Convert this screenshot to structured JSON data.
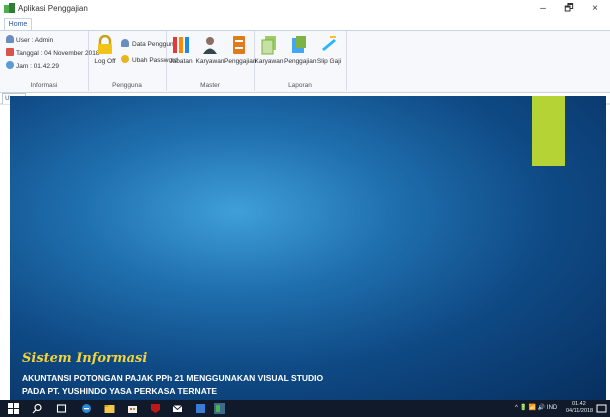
{
  "window": {
    "title": "Aplikasi Penggajian",
    "minimize": "–",
    "restore": "🗗",
    "close": "×"
  },
  "ribbon": {
    "tab_home": "Home",
    "informasi": {
      "user": "User : Admin",
      "tanggal": "Tanggal : 04 November 2018",
      "jam": "Jam : 01.42.29",
      "label": "Informasi"
    },
    "pengguna": {
      "logoff": "Log Off",
      "data_pengguna": "Data Pengguna",
      "ubah_password": "Ubah Password",
      "label": "Pengguna"
    },
    "master": {
      "jabatan": "Jabatan",
      "karyawan": "Karyawan",
      "penggajian": "Penggajian",
      "label": "Master"
    },
    "laporan": {
      "karyawan": "Karyawan",
      "penggajian": "Penggajian",
      "slip_gaji": "Slip Gaji",
      "label": "Laporan"
    }
  },
  "document_tab": "Utama",
  "desktop": {
    "heading": "Sistem Informasi",
    "line1": "AKUNTANSI POTONGAN PAJAK PPh 21 MENGGUNAKAN VISUAL STUDIO",
    "line2": "PADA PT. YUSHINDO YASA PERKASA TERNATE"
  },
  "taskbar": {
    "icons": [
      "windows-start-icon",
      "search-icon",
      "task-view-icon",
      "edge-browser-icon",
      "file-explorer-icon",
      "store-icon",
      "mcafee-icon",
      "mail-icon",
      "app-icon",
      "visual-studio-icon"
    ],
    "tray_text": "^ 🔋 📶 🔊 IND",
    "time": "01.42",
    "date": "04/11/2018"
  },
  "colors": {
    "accent_green": "#b5d334",
    "heading_yellow": "#f3d33b",
    "desktop_blue": "#1f6fae"
  }
}
